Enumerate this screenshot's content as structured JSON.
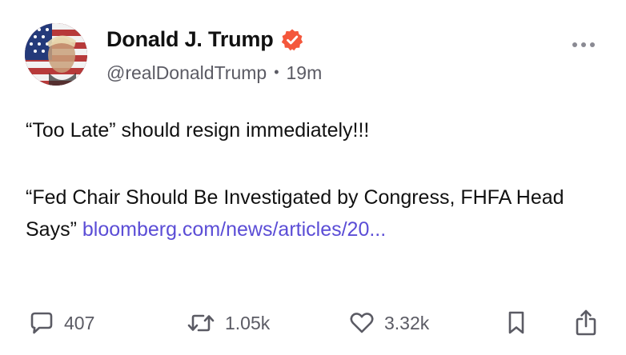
{
  "author": {
    "display_name": "Donald J. Trump",
    "handle": "@realDonaldTrump",
    "time_ago": "19m",
    "verified": true,
    "verified_color": "#f4573c"
  },
  "post": {
    "line1": "“Too Late” should resign immediately!!!",
    "quote_text": "“Fed Chair Should Be Investigated by Congress, FHFA Head Says” ",
    "link_text": "bloomberg.com/news/articles/20...",
    "link_color": "#5b4dd6"
  },
  "actions": {
    "replies": "407",
    "reposts": "1.05k",
    "likes": "3.32k"
  },
  "icons": {
    "more": "more-horizontal-icon",
    "reply": "comment-icon",
    "repost": "repost-icon",
    "like": "heart-icon",
    "bookmark": "bookmark-icon",
    "share": "share-icon"
  }
}
